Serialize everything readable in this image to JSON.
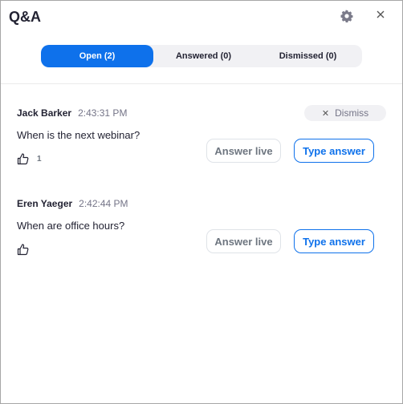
{
  "header": {
    "title": "Q&A",
    "settings_icon": "gear-icon",
    "close_icon": "close-icon"
  },
  "tabs": [
    {
      "label": "Open (2)",
      "active": true
    },
    {
      "label": "Answered (0)",
      "active": false
    },
    {
      "label": "Dismissed (0)",
      "active": false
    }
  ],
  "questions": [
    {
      "author": "Jack Barker",
      "time": "2:43:31 PM",
      "text": "When is the next webinar?",
      "likes": "1",
      "dismiss_label": "Dismiss",
      "answer_live_label": "Answer live",
      "type_answer_label": "Type answer"
    },
    {
      "author": "Eren Yaeger",
      "time": "2:42:44 PM",
      "text": "When are office hours?",
      "likes": "",
      "answer_live_label": "Answer live",
      "type_answer_label": "Type answer"
    }
  ],
  "colors": {
    "accent": "#0e71eb",
    "tab_bg": "#f1f1f4",
    "text": "#232333",
    "muted": "#747487"
  }
}
